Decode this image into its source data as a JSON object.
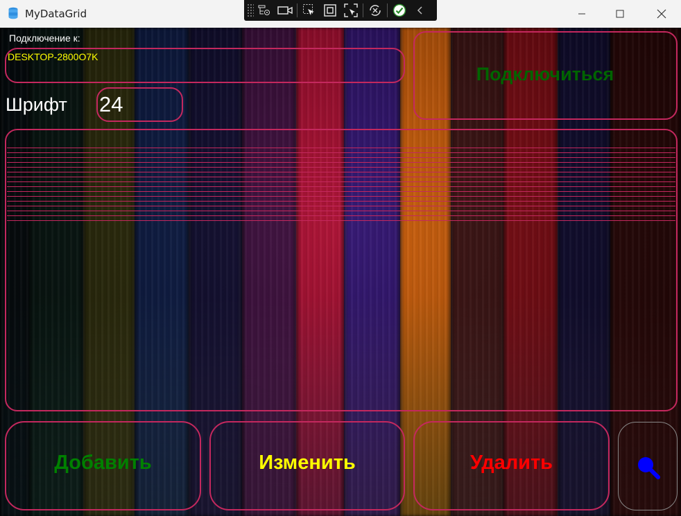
{
  "window": {
    "title": "MyDataGrid",
    "controls": [
      "minimize",
      "maximize",
      "close"
    ]
  },
  "debug_toolbar": {
    "icons": [
      "live-visual-tree-icon",
      "record-icon",
      "select-element-icon",
      "display-layout-adorners-icon",
      "track-focus-icon",
      "hot-reload-icon",
      "check-icon",
      "collapse-icon"
    ]
  },
  "connection": {
    "label": "Подключение к:",
    "server": "DESKTOP-2800O7K",
    "connect_button": "Подключиться",
    "connect_color": "#006400"
  },
  "font": {
    "label": "Шрифт",
    "value": "24"
  },
  "actions": {
    "add": {
      "label": "Добавить",
      "color": "#008000"
    },
    "edit": {
      "label": "Изменить",
      "color": "#ffff00"
    },
    "delete": {
      "label": "Удалить",
      "color": "#ff0000"
    },
    "search_icon_color": "#0000ff"
  },
  "colors": {
    "border_accent": "#c4285e",
    "planks": [
      "#15303a",
      "#1e4a3f",
      "#6b6a2a",
      "#2e4f86",
      "#352a6b",
      "#7a2c7a",
      "#d12a6a",
      "#6a3aa8",
      "#e89a1a",
      "#7a3a3a",
      "#b8283e",
      "#3a2e70",
      "#6a1e1e"
    ]
  }
}
